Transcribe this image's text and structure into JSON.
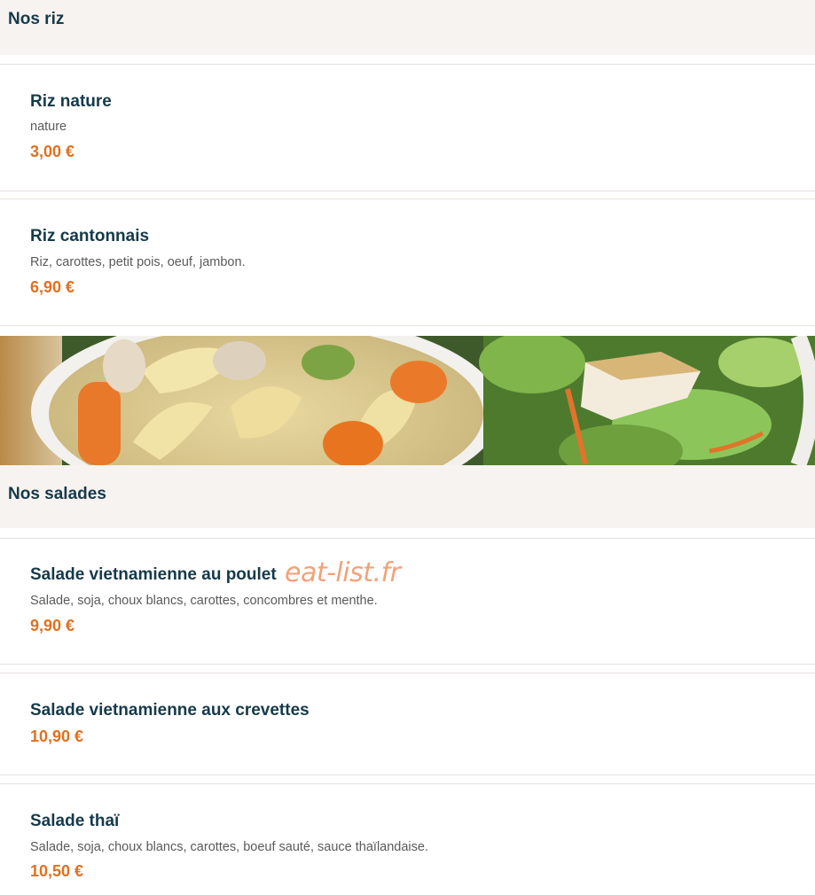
{
  "sections": {
    "riz": {
      "title": "Nos riz",
      "items": [
        {
          "name": "Riz nature",
          "description": "nature",
          "price": "3,00 €"
        },
        {
          "name": "Riz cantonnais",
          "description": "Riz, carottes, petit pois, oeuf, jambon.",
          "price": "6,90 €"
        }
      ]
    },
    "salades": {
      "title": "Nos salades",
      "items": [
        {
          "name": "Salade vietnamienne au poulet",
          "description": "Salade, soja, choux blancs, carottes, concombres et menthe.",
          "price": "9,90 €"
        },
        {
          "name": "Salade vietnamienne aux crevettes",
          "price": "10,90 €"
        },
        {
          "name": "Salade thaï",
          "description": "Salade, soja, choux blancs, carottes, boeuf sauté, sauce thaïlandaise.",
          "price": "10,50 €"
        }
      ]
    }
  },
  "watermark": "eat-list.fr",
  "banner_image": "food-banner-soup-and-salad",
  "colors": {
    "title": "#153a4a",
    "price": "#e0701f",
    "section_bg": "#f7f3f0",
    "watermark": "#f2a27a"
  }
}
